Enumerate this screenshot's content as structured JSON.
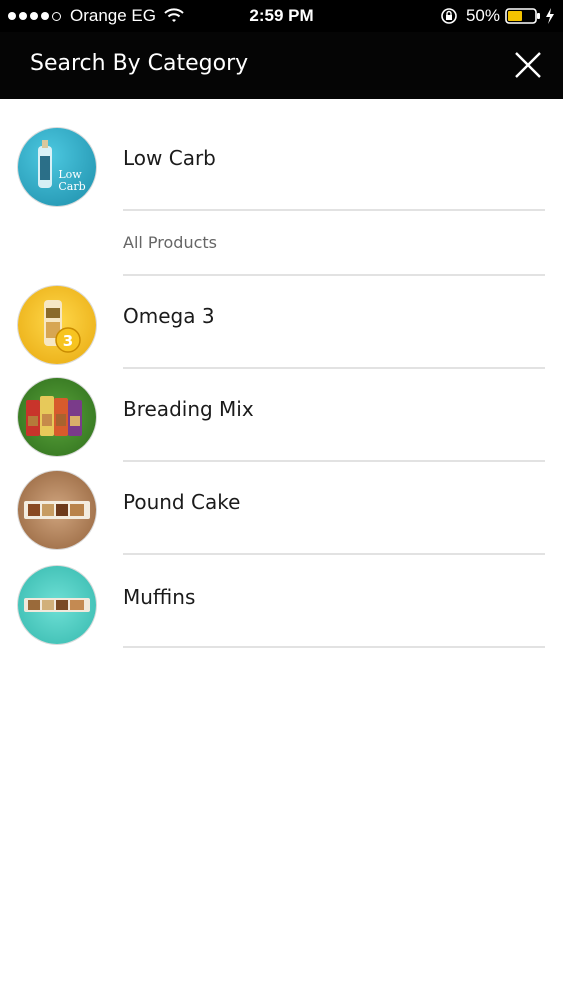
{
  "status_bar": {
    "carrier": "Orange EG",
    "time": "2:59 PM",
    "battery": "50%"
  },
  "header": {
    "title": "Search By Category"
  },
  "categories": [
    {
      "label": "Low Carb",
      "thumb_text": "Low Carb",
      "sub_items": [
        "All Products"
      ]
    },
    {
      "label": "Omega 3",
      "thumb_text": "3"
    },
    {
      "label": "Breading Mix"
    },
    {
      "label": "Pound Cake"
    },
    {
      "label": "Muffins"
    }
  ],
  "colors": {
    "header_bg": "#050505",
    "low_carb": "#2aa9c6",
    "omega": "#f0c21a",
    "breading": "#3e8a2a",
    "pound_cake": "#b58a64",
    "muffins": "#4fd0c7"
  }
}
